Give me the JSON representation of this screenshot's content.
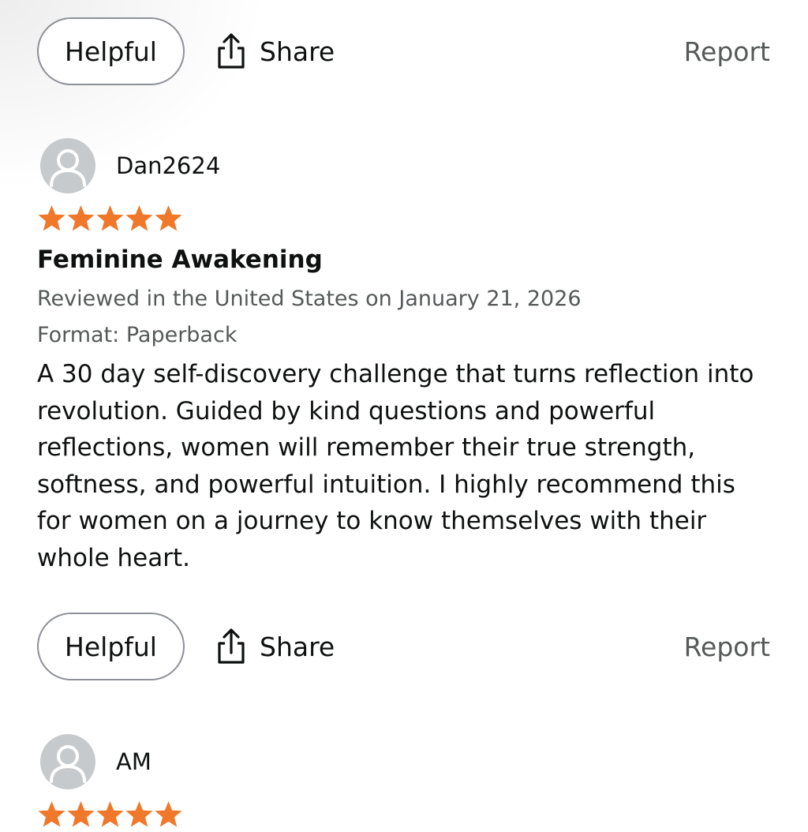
{
  "actions": {
    "helpful_label": "Helpful",
    "share_label": "Share",
    "report_label": "Report"
  },
  "reviews": [
    {
      "username": "Dan2624",
      "rating": 5,
      "rating_max": 5,
      "title": "Feminine Awakening",
      "reviewed_in": "Reviewed in the United States on January 21, 2026",
      "format": "Format: Paperback",
      "body": "A 30 day self-discovery challenge that turns reflection into revolution. Guided by kind questions and powerful reflections, women will remember their true strength, softness, and powerful intuition. I highly recommend this for women on a journey to know themselves with their whole heart."
    },
    {
      "username": "AM",
      "rating": 5,
      "rating_max": 5
    }
  ],
  "colors": {
    "star": "#f0782a",
    "avatar_bg": "#c7cacc",
    "avatar_fg": "#ffffff",
    "pill_border": "#8d9096",
    "muted_text": "#565959"
  },
  "icons": {
    "share": "share-icon",
    "avatar": "person-icon",
    "star": "star-icon"
  }
}
